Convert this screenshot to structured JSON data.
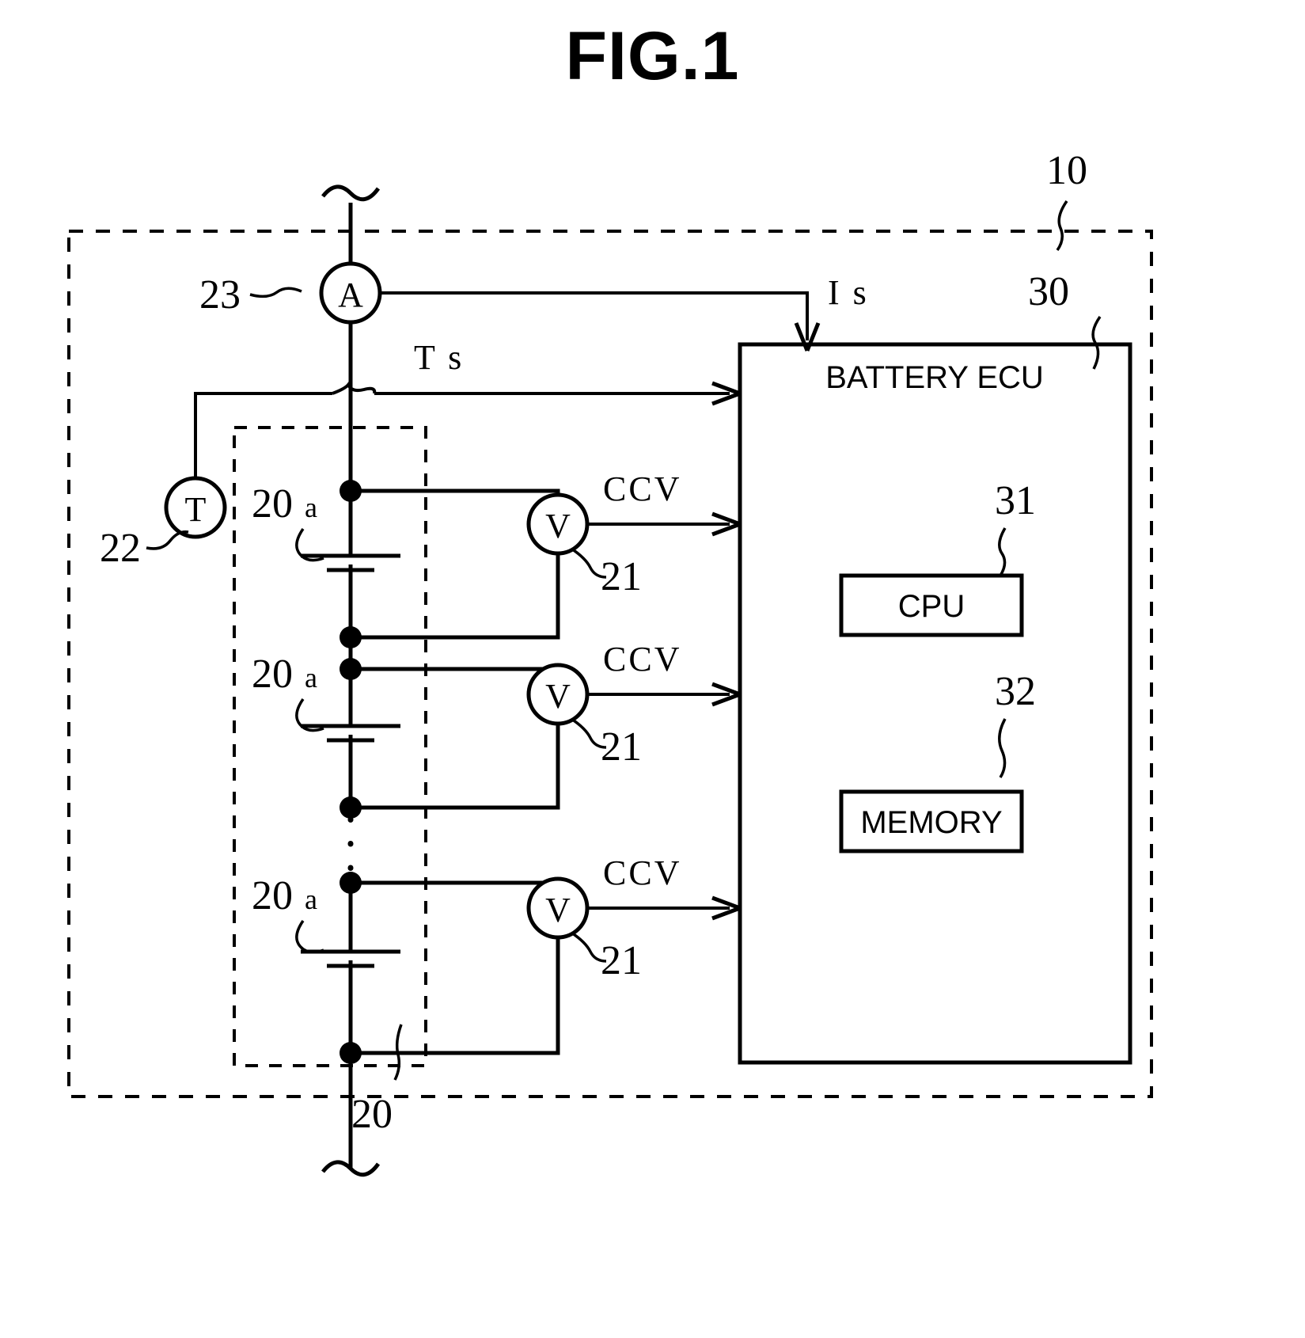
{
  "figure": {
    "title": "FIG.1",
    "type": "patent-schematic-diagram",
    "subject": "Battery monitoring system with battery ECU"
  },
  "reference_numerals": {
    "system": "10",
    "battery_pack": "20",
    "battery_cell": "20",
    "battery_cell_suffix": "a",
    "voltage_sensor": "21",
    "temperature_sensor": "22",
    "current_sensor": "23",
    "battery_ecu": "30",
    "cpu": "31",
    "memory": "32"
  },
  "blocks": {
    "ecu_title": "BATTERY ECU",
    "cpu_label": "CPU",
    "memory_label": "MEMORY"
  },
  "meters": {
    "ammeter_symbol": "A",
    "voltmeter_symbol": "V",
    "thermometer_symbol": "T"
  },
  "signals": {
    "current": "I s",
    "temperature": "T s",
    "voltage_1": "CCV",
    "voltage_2": "CCV",
    "voltage_3": "CCV"
  },
  "cells": [
    {
      "numeral": "20",
      "suffix": "a",
      "sensor_numeral": "21",
      "signal": "CCV"
    },
    {
      "numeral": "20",
      "suffix": "a",
      "sensor_numeral": "21",
      "signal": "CCV"
    },
    {
      "numeral": "20",
      "suffix": "a",
      "sensor_numeral": "21",
      "signal": "CCV"
    }
  ],
  "colors": {
    "ink": "#000000",
    "paper": "#ffffff"
  }
}
